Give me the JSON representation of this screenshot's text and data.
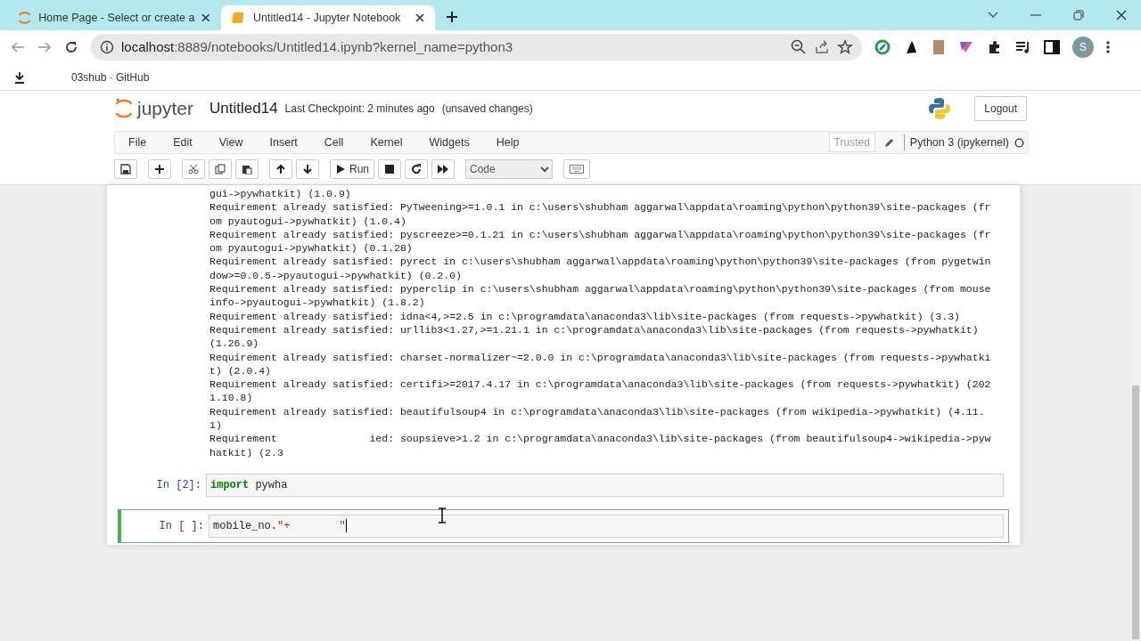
{
  "browser": {
    "tabs": [
      {
        "title": "Home Page - Select or create a",
        "selected": false
      },
      {
        "title": "Untitled14 - Jupyter Notebook",
        "selected": true
      }
    ],
    "url_host": "localhost",
    "url_path": ":8889/notebooks/Untitled14.ipynb?kernel_name=python3",
    "profile_initial": "S",
    "bookmarks": [
      {
        "label": "03shub · GitHub"
      }
    ]
  },
  "notebook": {
    "logo_text": "jupyter",
    "name": "Untitled14",
    "checkpoint": "Last Checkpoint: 2 minutes ago",
    "unsaved": "(unsaved changes)",
    "logout": "Logout",
    "menu": [
      "File",
      "Edit",
      "View",
      "Insert",
      "Cell",
      "Kernel",
      "Widgets",
      "Help"
    ],
    "trusted": "Trusted",
    "kernel": "Python 3 (ipykernel)",
    "run_label": "Run",
    "cell_type": "Code"
  },
  "output_lines": [
    "gui->pywhatkit) (1.0.9)",
    "Requirement already satisfied: PyTweening>=1.0.1 in c:\\users\\shubham aggarwal\\appdata\\roaming\\python\\python39\\site-packages (fr",
    "om pyautogui->pywhatkit) (1.0.4)",
    "Requirement already satisfied: pyscreeze>=0.1.21 in c:\\users\\shubham aggarwal\\appdata\\roaming\\python\\python39\\site-packages (fr",
    "om pyautogui->pywhatkit) (0.1.28)",
    "Requirement already satisfied: pyrect in c:\\users\\shubham aggarwal\\appdata\\roaming\\python\\python39\\site-packages (from pygetwin",
    "dow>=0.0.5->pyautogui->pywhatkit) (0.2.0)",
    "Requirement already satisfied: pyperclip in c:\\users\\shubham aggarwal\\appdata\\roaming\\python\\python39\\site-packages (from mouse",
    "info->pyautogui->pywhatkit) (1.8.2)",
    "Requirement already satisfied: idna<4,>=2.5 in c:\\programdata\\anaconda3\\lib\\site-packages (from requests->pywhatkit) (3.3)",
    "Requirement already satisfied: urllib3<1.27,>=1.21.1 in c:\\programdata\\anaconda3\\lib\\site-packages (from requests->pywhatkit)",
    "(1.26.9)",
    "Requirement already satisfied: charset-normalizer~=2.0.0 in c:\\programdata\\anaconda3\\lib\\site-packages (from requests->pywhatki",
    "t) (2.0.4)",
    "Requirement already satisfied: certifi>=2017.4.17 in c:\\programdata\\anaconda3\\lib\\site-packages (from requests->pywhatkit) (202",
    "1.10.8)",
    "Requirement already satisfied: beautifulsoup4 in c:\\programdata\\anaconda3\\lib\\site-packages (from wikipedia->pywhatkit) (4.11.",
    "1)",
    "Requirement               ied: soupsieve>1.2 in c:\\programdata\\anaconda3\\lib\\site-packages (from beautifulsoup4->wikipedia->pyw",
    "hatkit) (2.3"
  ],
  "cells": [
    {
      "prompt": "In [2]:",
      "selected": false,
      "tokens": [
        {
          "kind": "keyword",
          "text": "import"
        },
        {
          "kind": "plain",
          "text": " pywha"
        }
      ]
    },
    {
      "prompt": "In [ ]:",
      "selected": true,
      "tokens": [
        {
          "kind": "plain",
          "text": "mobile_no."
        },
        {
          "kind": "string",
          "text": "\"+"
        },
        {
          "kind": "hidden"
        },
        {
          "kind": "string",
          "text": "\""
        }
      ]
    }
  ]
}
